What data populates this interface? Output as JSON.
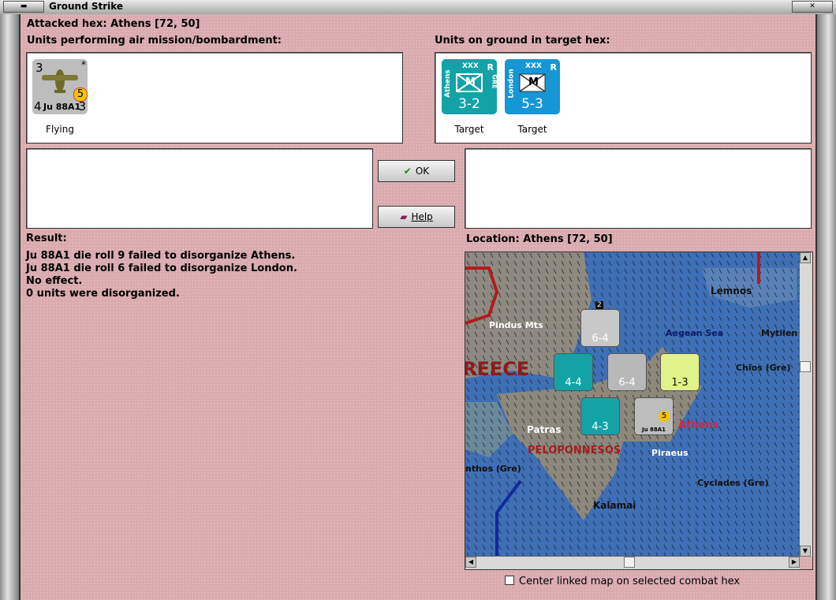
{
  "window": {
    "title": "Ground Strike"
  },
  "header": {
    "attacked_hex": "Attacked hex: Athens  [72, 50]"
  },
  "air_units": {
    "label": "Units performing air mission/bombardment:",
    "items": [
      {
        "top_left": "3",
        "star": "*",
        "bottom": "4",
        "name": "Ju 88A1",
        "bottom_right": "3",
        "badge": "5",
        "status": "Flying"
      }
    ]
  },
  "ground_units": {
    "label": "Units on ground in target hex:",
    "items": [
      {
        "size": "XXX",
        "corner": "R",
        "side_left": "Athens",
        "side_right": "GRE",
        "symbol": "M",
        "strength": "3-2",
        "status": "Target",
        "color": "#13a3a7"
      },
      {
        "size": "XXX",
        "corner": "R",
        "side_left": "London",
        "side_right": "",
        "symbol": "M",
        "strength": "5-3",
        "status": "Target",
        "color": "#1796d6"
      }
    ]
  },
  "buttons": {
    "ok": "OK",
    "help": "Help"
  },
  "result": {
    "label": "Result:",
    "lines": [
      "Ju 88A1 die roll 9 failed to disorganize Athens.",
      "Ju 88A1 die roll 6 failed to disorganize London.",
      "No effect.",
      "0 units were disorganized."
    ]
  },
  "location": {
    "label": "Location:  Athens  [72, 50]",
    "map_labels": {
      "lemnos": "Lemnos",
      "pindus": "Pindus Mts",
      "aegean": "Aegean Sea",
      "mytilene": "Mytilen",
      "chios": "Chios (Gre)",
      "greece": "REECE",
      "patras": "Patras",
      "athens": "Athens",
      "peloponnesos": "PELOPONNESOS",
      "piraeus": "Piraeus",
      "zakynthos": "nthos (Gre)",
      "cyclades": "Cyclades (Gre)",
      "kalamai": "Kalamai"
    },
    "map_units": [
      {
        "strength": "6-4",
        "color": "#c8c8c8",
        "stack": "2"
      },
      {
        "strength": "4-4",
        "color": "#13a3a7"
      },
      {
        "strength": "6-4",
        "color": "#b8b8b8"
      },
      {
        "strength": "1-3",
        "color": "#e2f28a"
      },
      {
        "strength": "4-3",
        "color": "#13a3a7"
      }
    ]
  },
  "options": {
    "center_map": "Center linked map on selected combat hex"
  }
}
